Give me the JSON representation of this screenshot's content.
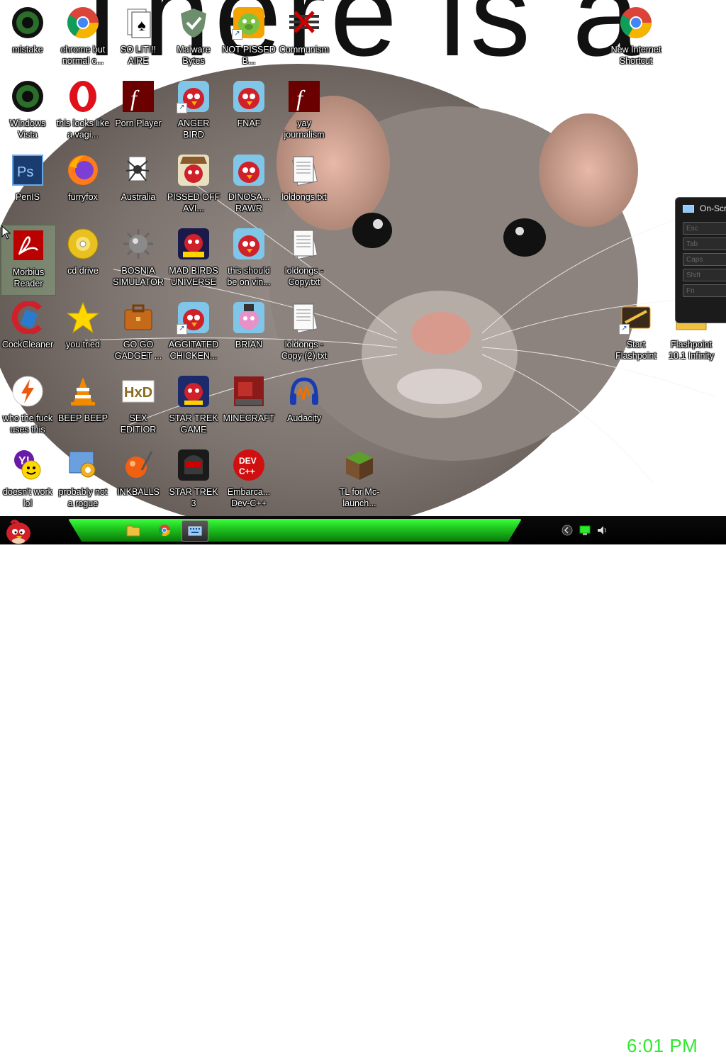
{
  "wallpaper": {
    "text": "There is a"
  },
  "desktop_icons": [
    {
      "label": "mistake"
    },
    {
      "label": "chrome but normal c..."
    },
    {
      "label": "SO LIT!!! AIRE"
    },
    {
      "label": "Malware Bytes"
    },
    {
      "label": "NOT PISSED B..."
    },
    {
      "label": "Communism"
    },
    {
      "label": "New Internet Shortcut"
    },
    {
      "label": "Windows Vista"
    },
    {
      "label": "this looks like a vagi..."
    },
    {
      "label": "Porn Player"
    },
    {
      "label": "ANGER BIRD"
    },
    {
      "label": "FNAF"
    },
    {
      "label": "yay journalism"
    },
    {
      "label": "PenIS"
    },
    {
      "label": "furryfox"
    },
    {
      "label": "Australia"
    },
    {
      "label": "PISSED OFF AVI..."
    },
    {
      "label": "DINOSA... RAWR"
    },
    {
      "label": "loldongs.txt"
    },
    {
      "label": "Morbius Reader"
    },
    {
      "label": "cd drive"
    },
    {
      "label": "BOSNIA SIMULATOR"
    },
    {
      "label": "MAD BIRDS UNIVERSE"
    },
    {
      "label": "this should be on vin..."
    },
    {
      "label": "loldongs - Copy.txt"
    },
    {
      "label": "CockCleaner"
    },
    {
      "label": "you tried"
    },
    {
      "label": "GO GO GADGET ..."
    },
    {
      "label": "AGGITATED CHICKEN..."
    },
    {
      "label": "BRIAN"
    },
    {
      "label": "loldongs - Copy (2).txt"
    },
    {
      "label": "Start Flashpoint"
    },
    {
      "label": "Flashpoint 10.1 Infinity"
    },
    {
      "label": "who the fuck uses this"
    },
    {
      "label": "BEEP BEEP"
    },
    {
      "label": "SEX EDITIOR"
    },
    {
      "label": "STAR TREK GAME"
    },
    {
      "label": "MINECRAFT"
    },
    {
      "label": "Audacity"
    },
    {
      "label": "doesn't work lol"
    },
    {
      "label": "probably not a rogue"
    },
    {
      "label": "INKBALLS"
    },
    {
      "label": "STAR TREK 3"
    },
    {
      "label": "Embarca... Dev-C++"
    },
    {
      "label": "TL for Mc-launch..."
    }
  ],
  "osk_window": {
    "title": "On-Scre",
    "keys": [
      "Esc",
      "Tab",
      "Caps",
      "Shift",
      "Fn"
    ]
  },
  "taskbar": {
    "clock": "6:01 PM",
    "accent_color": "#22dd22",
    "pinned": [
      {
        "name": "file-explorer-icon"
      },
      {
        "name": "chrome-icon"
      },
      {
        "name": "on-screen-keyboard-icon"
      }
    ]
  }
}
